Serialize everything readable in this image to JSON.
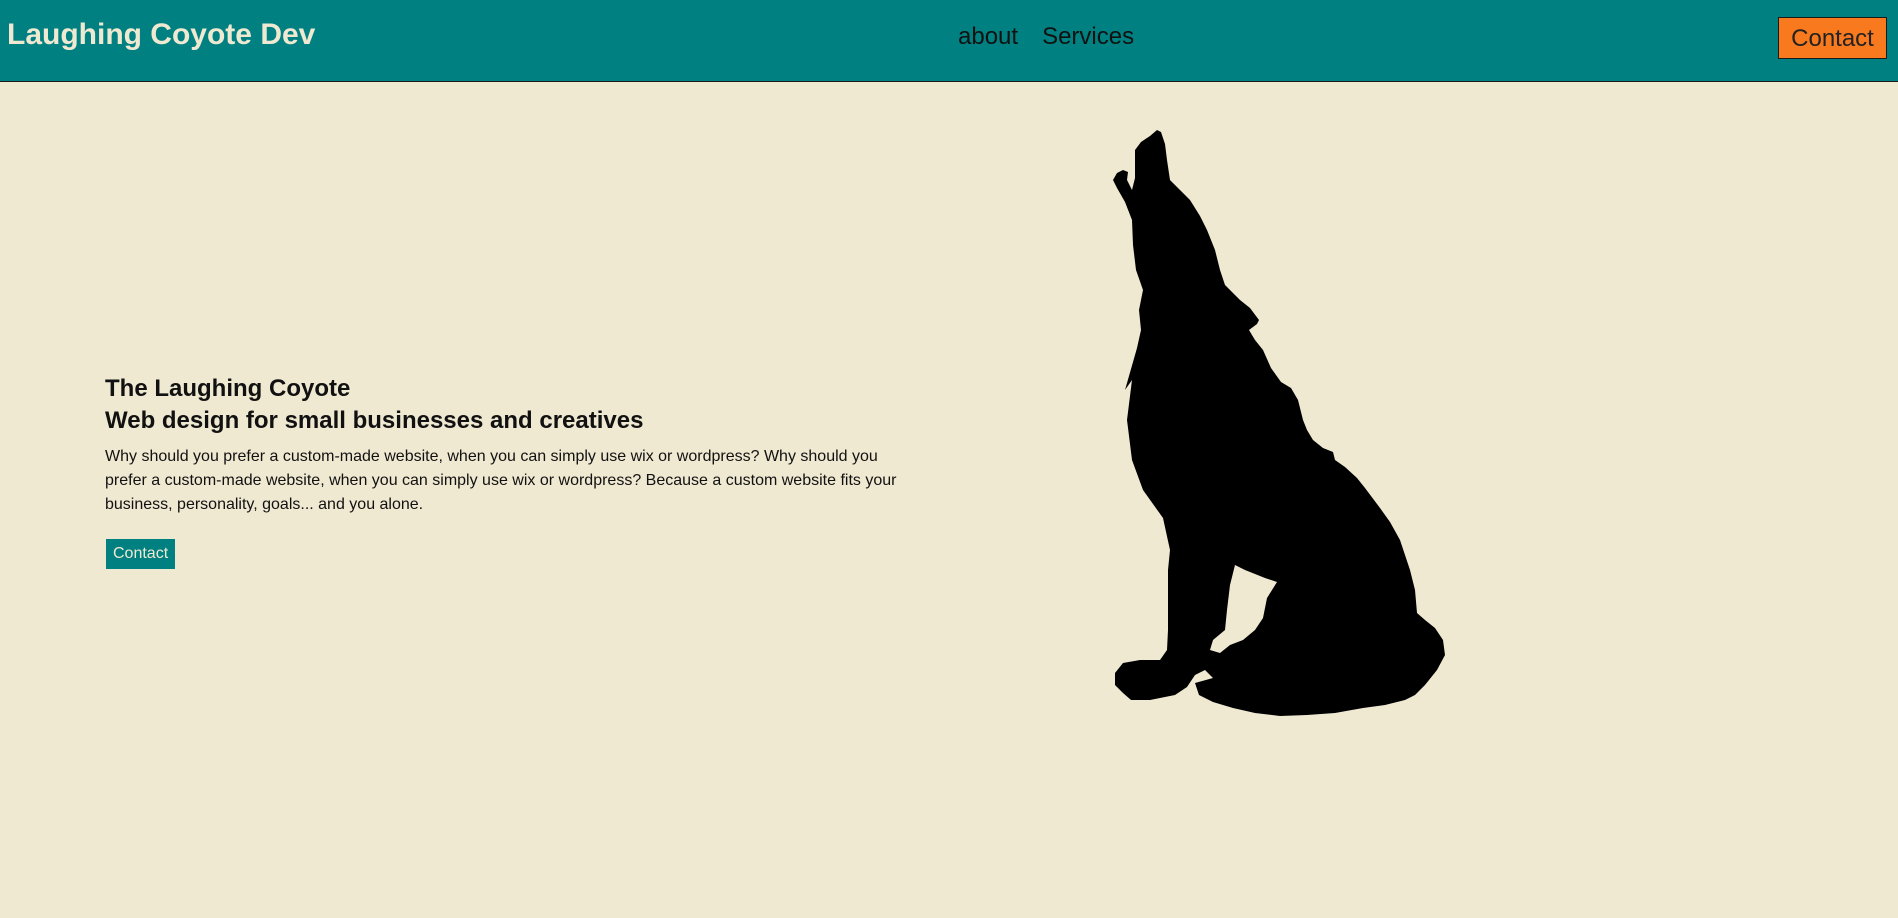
{
  "header": {
    "brand": "Laughing Coyote Dev",
    "nav": [
      {
        "label": "about"
      },
      {
        "label": "Services"
      }
    ],
    "contact_label": "Contact"
  },
  "hero": {
    "title_line1": "The Laughing Coyote",
    "title_line2": "Web design for small businesses and creatives",
    "description": "Why should you prefer a custom-made website, when you can simply use wix or wordpress? Why should you prefer a custom-made website, when you can simply use wix or wordpress? Because a custom website fits your business, personality, goals... and you alone.",
    "contact_label": "Contact"
  },
  "image": {
    "icon": "howling-coyote-silhouette"
  },
  "colors": {
    "header_bg": "#008080",
    "page_bg": "#f0e9d2",
    "accent_orange": "#f97a1e"
  }
}
